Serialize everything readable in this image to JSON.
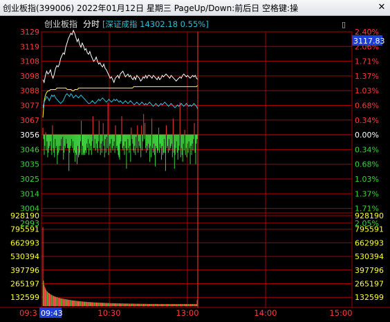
{
  "window": {
    "title": "创业板指(399006) 2022年01月12日 星期三 PageUp/Down:前后日 空格键:操",
    "close_symbol": "✕"
  },
  "header": {
    "index_name": "创业板指",
    "mode_label": "分时",
    "compare_text": "[深证成指 14302.18 0.55%]",
    "toggle_symbol": "▯"
  },
  "current_price_tag": "3117.83",
  "cursor_time_tag": "09:43",
  "colors": {
    "up": "#ff3b3b",
    "down": "#3fd33f",
    "flat": "#ffffff",
    "grid": "#a80000",
    "main_line": "#ffffff",
    "avg_line": "#ffff33",
    "compare_line": "#33c6e6",
    "volume_text": "#ffff33",
    "highlight": "#2f6eff"
  },
  "price_axis": [
    {
      "price": "3129",
      "pct": "2.40%",
      "dir": "up"
    },
    {
      "price": "3119",
      "pct": "2.06%",
      "dir": "up"
    },
    {
      "price": "3108",
      "pct": "1.71%",
      "dir": "up"
    },
    {
      "price": "3098",
      "pct": "1.37%",
      "dir": "up"
    },
    {
      "price": "3088",
      "pct": "1.03%",
      "dir": "up"
    },
    {
      "price": "3077",
      "pct": "0.68%",
      "dir": "up"
    },
    {
      "price": "3067",
      "pct": "0.34%",
      "dir": "up"
    },
    {
      "price": "3056",
      "pct": "0.00%",
      "dir": "flat"
    },
    {
      "price": "3046",
      "pct": "0.34%",
      "dir": "down"
    },
    {
      "price": "3035",
      "pct": "0.68%",
      "dir": "down"
    },
    {
      "price": "3025",
      "pct": "1.03%",
      "dir": "down"
    },
    {
      "price": "3014",
      "pct": "1.37%",
      "dir": "down"
    },
    {
      "price": "3004",
      "pct": "1.71%",
      "dir": "down"
    },
    {
      "price": "2993",
      "pct": "2.05%",
      "dir": "down"
    }
  ],
  "volume_axis": [
    "928190",
    "795591",
    "662993",
    "530394",
    "397796",
    "265197",
    "132599"
  ],
  "time_axis": [
    "09:3",
    "10:30",
    "13:00",
    "14:00",
    "15:00"
  ],
  "chart_data": {
    "type": "line",
    "price_range": [
      2993,
      3129
    ],
    "prev_close": 3056,
    "volume_range": [
      0,
      928190
    ],
    "time_label_first": "09:30",
    "time_label_mid": [
      "10:30",
      "13:00",
      "14:00"
    ],
    "time_label_last": "15:00",
    "series": [
      {
        "key": "price",
        "values": [
          3095,
          3093,
          3098,
          3101,
          3099,
          3100,
          3102,
          3098,
          3096,
          3099,
          3103,
          3105,
          3104,
          3106,
          3110,
          3112,
          3114,
          3113,
          3118,
          3121,
          3124,
          3126,
          3128,
          3127,
          3130,
          3128,
          3125,
          3122,
          3124,
          3120,
          3118,
          3121,
          3119,
          3116,
          3117,
          3114,
          3113,
          3115,
          3112,
          3110,
          3108,
          3109,
          3111,
          3108,
          3106,
          3107,
          3105,
          3104,
          3106,
          3103,
          3102,
          3100,
          3098,
          3096,
          3097,
          3095,
          3093,
          3096,
          3097,
          3098,
          3096,
          3099,
          3100,
          3101,
          3099,
          3097,
          3098,
          3099,
          3097,
          3098,
          3096,
          3095,
          3097,
          3095,
          3098,
          3097,
          3096,
          3094,
          3095,
          3097,
          3096,
          3098,
          3096,
          3098,
          3098,
          3097,
          3096,
          3098,
          3097,
          3096,
          3095,
          3097,
          3095,
          3096,
          3098,
          3097,
          3098,
          3099,
          3098,
          3097,
          3096,
          3098,
          3097,
          3096,
          3095,
          3094,
          3095,
          3096,
          3097,
          3096,
          3098,
          3099,
          3098,
          3097,
          3098,
          3097,
          3096,
          3097,
          3098,
          3097,
          3098,
          3096,
          3095
        ]
      },
      {
        "key": "average",
        "values": [
          3068,
          3080,
          3084,
          3086,
          3087,
          3087,
          3088,
          3088,
          3088,
          3088,
          3088,
          3089,
          3089,
          3089,
          3089,
          3089,
          3089,
          3089,
          3089,
          3088,
          3088,
          3088,
          3088,
          3087,
          3087,
          3088,
          3088,
          3088,
          3089,
          3089,
          3089,
          3089,
          3089,
          3089,
          3089,
          3089,
          3089,
          3089,
          3089,
          3089,
          3089,
          3089,
          3089,
          3089,
          3089,
          3089,
          3089,
          3089,
          3089,
          3089,
          3089,
          3089,
          3089,
          3089,
          3089,
          3089,
          3089,
          3089,
          3089,
          3089,
          3089,
          3089,
          3089,
          3089,
          3089,
          3089,
          3089,
          3089,
          3089,
          3089,
          3089,
          3090,
          3090,
          3090,
          3090,
          3090,
          3090,
          3090,
          3090,
          3090,
          3090,
          3090,
          3090,
          3090,
          3090,
          3090,
          3090,
          3090,
          3090,
          3090,
          3090,
          3090,
          3090,
          3090,
          3090,
          3090,
          3090,
          3090,
          3090,
          3090,
          3090,
          3090,
          3090,
          3090,
          3090,
          3090,
          3090,
          3090,
          3090,
          3090,
          3090,
          3090,
          3090,
          3090,
          3090,
          3090,
          3090,
          3090,
          3090,
          3090,
          3090,
          3091
        ]
      },
      {
        "key": "compare",
        "values": [
          3075,
          3079,
          3081,
          3083,
          3082,
          3080,
          3082,
          3084,
          3083,
          3084,
          3082,
          3081,
          3080,
          3079,
          3078,
          3079,
          3080,
          3082,
          3084,
          3085,
          3084,
          3083,
          3085,
          3084,
          3082,
          3083,
          3084,
          3083,
          3082,
          3083,
          3084,
          3083,
          3082,
          3081,
          3080,
          3079,
          3078,
          3078,
          3079,
          3080,
          3079,
          3078,
          3079,
          3080,
          3081,
          3080,
          3081,
          3082,
          3081,
          3080,
          3079,
          3080,
          3081,
          3080,
          3079,
          3080,
          3081,
          3080,
          3081,
          3080,
          3079,
          3080,
          3079,
          3078,
          3079,
          3080,
          3079,
          3078,
          3079,
          3080,
          3079,
          3078,
          3077,
          3078,
          3079,
          3078,
          3077,
          3078,
          3079,
          3078,
          3077,
          3078,
          3077,
          3078,
          3079,
          3078,
          3077,
          3076,
          3077,
          3078,
          3077,
          3076,
          3077,
          3078,
          3077,
          3078,
          3079,
          3078,
          3077,
          3076,
          3077,
          3078,
          3077,
          3076,
          3075,
          3076,
          3077,
          3076,
          3077,
          3078,
          3077,
          3076,
          3077,
          3078,
          3077,
          3076,
          3077,
          3076,
          3077,
          3078,
          3077,
          3076,
          3074
        ]
      }
    ],
    "breadth_bars": [
      3,
      2,
      9,
      5,
      1,
      7,
      3,
      10,
      8,
      6,
      5,
      3,
      7,
      9,
      4,
      6,
      8,
      10,
      2,
      6,
      5,
      13,
      9,
      8,
      5,
      7,
      5,
      2,
      7,
      1,
      11,
      8,
      5,
      6,
      2,
      4,
      6,
      6,
      16,
      8,
      6,
      5,
      2,
      6,
      3,
      8,
      7,
      12,
      8,
      9,
      13,
      5,
      10,
      9,
      8,
      3,
      6,
      9,
      5,
      9,
      8,
      9,
      7,
      8,
      4,
      6,
      2,
      9,
      4,
      7,
      5,
      9,
      3,
      8,
      6,
      6,
      2,
      7,
      4,
      6,
      8,
      3,
      6,
      6,
      9,
      4,
      8,
      3,
      5,
      5,
      10,
      2,
      8,
      1,
      6,
      14,
      9,
      5,
      4,
      8,
      2,
      6,
      7,
      5,
      3,
      8,
      4,
      6,
      5,
      7,
      9,
      10,
      11,
      4,
      3,
      8,
      6,
      7,
      5,
      9,
      3,
      6,
      15,
      7,
      2,
      6,
      8,
      5,
      12,
      3,
      2,
      4,
      7,
      8,
      5,
      9,
      1,
      6,
      4,
      8,
      3,
      5,
      6,
      10,
      4,
      7,
      3,
      9,
      2,
      5,
      6,
      8,
      5,
      7,
      4,
      6,
      12,
      5,
      10,
      7,
      6,
      8,
      4,
      9,
      14,
      5,
      6,
      8,
      7,
      3,
      8,
      4,
      6,
      11,
      5,
      9,
      8,
      2,
      8,
      16,
      4,
      6,
      5,
      8,
      2,
      7,
      6,
      5,
      4,
      10,
      7,
      8,
      15,
      9,
      6,
      3,
      8,
      11,
      7,
      5,
      14,
      10,
      6,
      9,
      12,
      4,
      7,
      2,
      9,
      6,
      10,
      4,
      8,
      3,
      6,
      13,
      5,
      9,
      4,
      7,
      2,
      5,
      8,
      13,
      4,
      2
    ],
    "breadth_dirs": [
      1,
      -1,
      -1,
      -1,
      1,
      -1,
      -1,
      -1,
      -1,
      -1,
      -1,
      -1,
      -1,
      -1,
      1,
      -1,
      -1,
      -1,
      -1,
      -1,
      -1,
      -1,
      -1,
      -1,
      -1,
      -1,
      -1,
      -1,
      -1,
      -1,
      -1,
      -1,
      -1,
      -1,
      -1,
      -1,
      -1,
      -1,
      -1,
      -1,
      -1,
      -1,
      -1,
      -1,
      -1,
      -1,
      -1,
      -1,
      -1,
      -1,
      -1,
      -1,
      -1,
      -1,
      -1,
      -1,
      1,
      -1,
      -1,
      -1,
      -1,
      -1,
      -1,
      -1,
      -1,
      -1,
      -1,
      -1,
      -1,
      -1,
      -1,
      -1,
      -1,
      1,
      -1,
      -1,
      -1,
      -1,
      -1,
      -1,
      -1,
      -1,
      1,
      -1,
      -1,
      -1,
      -1,
      -1,
      1,
      -1,
      -1,
      -1,
      -1,
      -1,
      -1,
      1,
      -1,
      -1,
      -1,
      -1,
      -1,
      -1,
      -1,
      -1,
      -1,
      -1,
      1,
      -1,
      -1,
      -1,
      -1,
      -1,
      -1,
      -1,
      -1,
      1,
      -1,
      -1,
      -1,
      -1,
      -1,
      -1,
      -1,
      -1,
      -1,
      -1,
      -1,
      -1,
      -1,
      1,
      -1,
      -1,
      -1,
      -1,
      -1,
      -1,
      -1,
      -1,
      1,
      -1,
      -1,
      -1,
      -1,
      -1,
      1,
      -1,
      -1,
      1,
      -1,
      1,
      -1,
      -1,
      -1,
      -1,
      -1,
      -1,
      -1,
      -1,
      -1,
      1,
      -1,
      -1,
      -1,
      -1,
      -1,
      -1,
      -1,
      -1,
      -1,
      1,
      -1,
      -1,
      -1,
      -1,
      -1,
      -1,
      -1,
      -1,
      -1,
      -1,
      1,
      -1,
      -1,
      -1,
      -1,
      -1,
      -1,
      -1,
      -1,
      -1,
      1,
      -1,
      -1,
      -1,
      -1,
      -1,
      -1,
      -1,
      -1,
      -1,
      1,
      -1,
      -1,
      -1,
      -1,
      -1,
      -1,
      1,
      -1,
      -1,
      -1,
      -1,
      -1,
      -1,
      -1,
      -1,
      -1,
      -1,
      -1,
      -1,
      -1,
      1,
      -1,
      -1,
      -1,
      -1,
      -1,
      -1,
      -1,
      -1,
      -1,
      -1,
      1,
      -1,
      -1,
      -1
    ],
    "volume": [
      780000,
      250000,
      210000,
      190000,
      175000,
      160000,
      150000,
      142000,
      135000,
      130000,
      126000,
      120000,
      115000,
      112000,
      108000,
      104000,
      101000,
      99000,
      96000,
      93000,
      91000,
      89000,
      87000,
      85000,
      83000,
      81000,
      80000,
      78000,
      77000,
      75000,
      74000,
      72000,
      71000,
      70000,
      69000,
      68000,
      66000,
      65000,
      64000,
      63000,
      62000,
      61000,
      60000,
      59000,
      58000,
      57000,
      56000,
      55000,
      55000,
      54000,
      53000,
      52000,
      51000,
      51000,
      50000,
      49000,
      48000,
      48000,
      47000,
      46000,
      46000,
      45000,
      44000,
      44000,
      43000,
      43000,
      42000,
      42000,
      41000,
      41000,
      40000,
      40000,
      39000,
      39000,
      38000,
      38000,
      38000,
      37000,
      37000,
      36000,
      36000,
      36000,
      35000,
      35000,
      35000,
      34000,
      34000,
      34000,
      33000,
      33000,
      33000,
      33000,
      32000,
      32000,
      32000,
      31000,
      31000,
      31000,
      31000,
      30000,
      30000,
      30000,
      30000,
      29000,
      29000,
      29000,
      29000,
      29000,
      28000,
      28000,
      28000,
      28000,
      28000,
      27000,
      27000,
      27000,
      27000,
      27000,
      27000,
      26000,
      26000,
      26000,
      26000,
      26000,
      26000,
      25000,
      25000,
      25000,
      25000,
      25000,
      25000,
      25000,
      24000,
      24000,
      24000,
      24000,
      24000,
      24000,
      24000,
      24000,
      23000,
      23000,
      23000,
      23000,
      23000,
      23000,
      23000,
      23000,
      23000,
      22000,
      22000,
      22000,
      22000,
      22000,
      22000,
      22000,
      22000,
      22000,
      22000,
      22000,
      21000,
      21000,
      21000,
      21000,
      21000,
      21000,
      21000,
      21000,
      21000,
      21000,
      21000,
      21000,
      21000,
      21000,
      21000,
      21000,
      21000,
      20000,
      20000,
      20000,
      20000,
      20000,
      20000,
      20000,
      20000,
      20000,
      20000,
      20000,
      20000,
      20000,
      20000,
      20000,
      20000,
      20000,
      20000,
      20000,
      20000,
      20000,
      20000,
      20000,
      20000,
      20000,
      20000,
      20000,
      20000,
      20000,
      20000,
      20000,
      20000,
      20000,
      20000,
      20000,
      20000,
      20000,
      20000,
      20000,
      20000,
      20000,
      20000,
      20000,
      20000,
      20000,
      20000,
      20000,
      20000,
      20000,
      20000,
      20000,
      20000,
      20000,
      20000,
      20000,
      20000,
      20000,
      20000,
      20000,
      60000
    ]
  }
}
